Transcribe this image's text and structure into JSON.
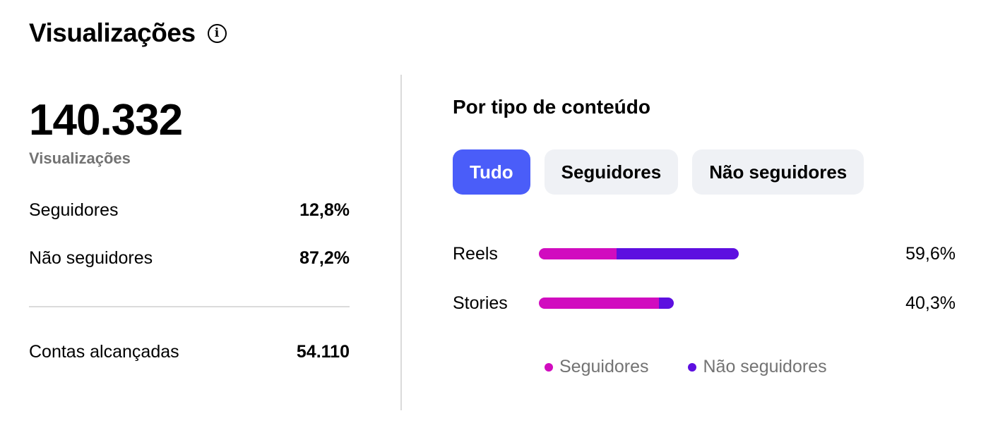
{
  "header": {
    "title": "Visualizações",
    "info_icon": "info-icon"
  },
  "summary": {
    "total": "140.332",
    "total_caption": "Visualizações",
    "rows": [
      {
        "label": "Seguidores",
        "value": "12,8%"
      },
      {
        "label": "Não seguidores",
        "value": "87,2%"
      }
    ],
    "accounts": {
      "label": "Contas alcançadas",
      "value": "54.110"
    }
  },
  "content_type": {
    "title": "Por tipo de conteúdo",
    "tabs": [
      {
        "label": "Tudo",
        "active": true
      },
      {
        "label": "Seguidores",
        "active": false
      },
      {
        "label": "Não seguidores",
        "active": false
      }
    ],
    "colors": {
      "followers": "#d10cbf",
      "non_followers": "#5d0fe0",
      "active_tab": "#4a5df9"
    },
    "bars": [
      {
        "label": "Reels",
        "percent_text": "59,6%",
        "total": 59.6,
        "followers_fraction": 0.39
      },
      {
        "label": "Stories",
        "percent_text": "40,3%",
        "total": 40.3,
        "followers_fraction": 0.89
      }
    ],
    "legend": {
      "followers": "Seguidores",
      "non_followers": "Não seguidores"
    }
  }
}
